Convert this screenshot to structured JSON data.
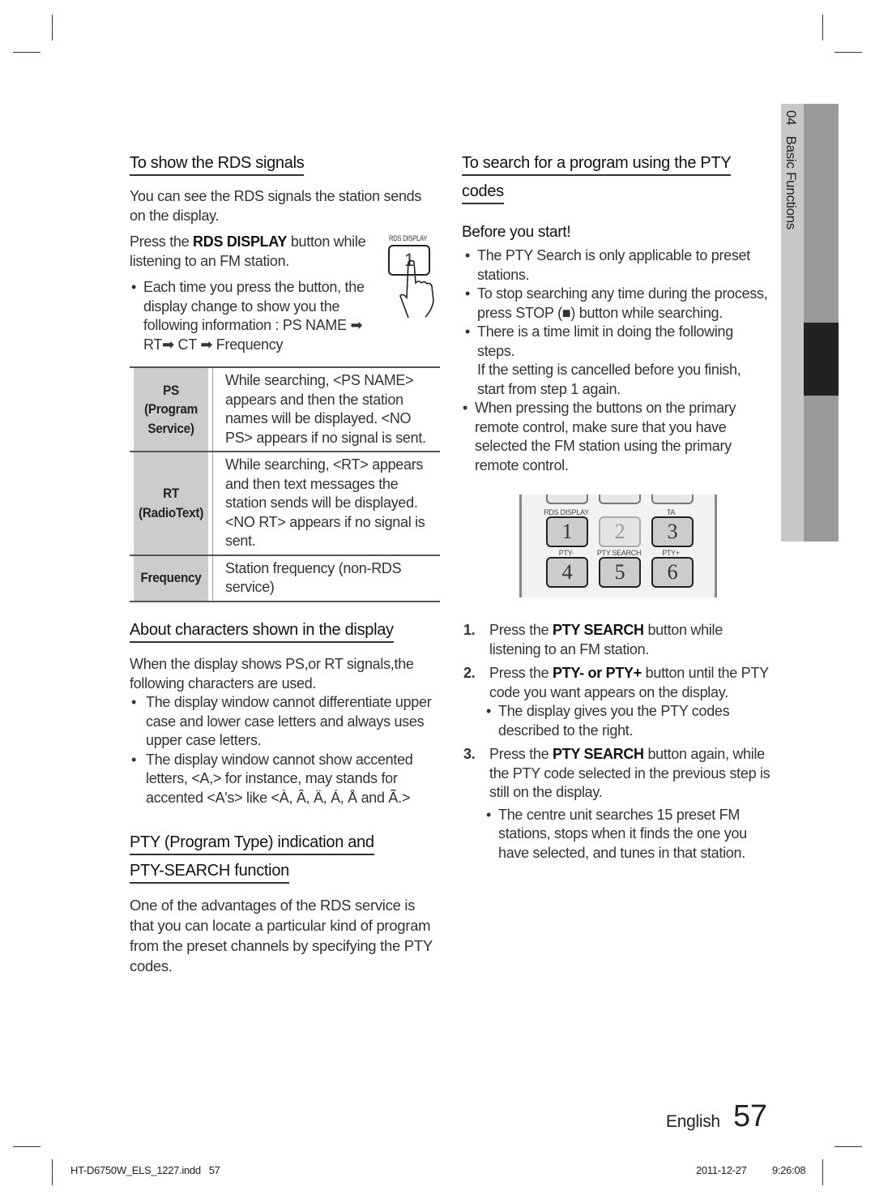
{
  "left": {
    "rds": {
      "heading": "To show the RDS signals",
      "intro": "You can see the RDS signals the station sends on the display.",
      "press_pre": "Press the ",
      "press_bold": "RDS DISPLAY",
      "press_post": " button while listening to an FM station.",
      "bullet": "Each time you press the button, the display change to show you the following information : PS NAME ➡ RT➡ CT ➡ Frequency",
      "illustration_label": "RDS DISPLAY",
      "illustration_key": "1"
    },
    "table": [
      {
        "key": "PS\n(Program\nService)",
        "value": "While searching, <PS NAME> appears and then the station names will be displayed. <NO PS> appears if no signal is sent."
      },
      {
        "key": "RT\n(RadioText)",
        "value": "While searching, <RT> appears and then text messages the station sends will be displayed. <NO RT> appears if no signal is sent."
      },
      {
        "key": "Frequency",
        "value": "Station frequency (non-RDS service)"
      }
    ],
    "chars": {
      "heading": "About characters shown in the display",
      "intro": "When the display shows PS,or RT signals,the following characters are used.",
      "bullets": [
        "The display window cannot differentiate upper case and lower case letters and always uses upper case letters.",
        "The display window cannot show accented letters, <A,> for instance, may stands for accented <A's> like <À, Â, Ä, Á, Å and Ã.>"
      ]
    },
    "pty": {
      "heading1": "PTY (Program Type) indication and",
      "heading2": "PTY-SEARCH function",
      "body": "One of the advantages of the RDS service is that you can locate a particular kind of program from the preset channels by specifying the PTY codes."
    }
  },
  "right": {
    "heading1": "To search for a program using the PTY",
    "heading2": "codes",
    "before": "Before you start!",
    "bullets": [
      "The PTY Search is only applicable to preset stations.",
      "To stop searching any time during the process, press STOP (■) button while searching.",
      "There is a time limit in doing the following steps.\nIf the setting is cancelled before you finish, start from step 1 again.",
      "When pressing the buttons on the primary remote control, make sure that you have selected the FM station using the primary remote control."
    ],
    "remote": {
      "labels": [
        "RDS DISPLAY",
        "",
        "TA",
        "PTY-",
        "PTY SEARCH",
        "PTY+"
      ],
      "keys": [
        "1",
        "2",
        "3",
        "4",
        "5",
        "6"
      ]
    },
    "steps": [
      {
        "n": "1.",
        "pre": "Press the ",
        "bold": "PTY SEARCH",
        "post": " button while listening to an FM station.",
        "sub": ""
      },
      {
        "n": "2.",
        "pre": "Press the ",
        "bold": "PTY- or PTY+",
        "post": " button until the PTY code you want appears on the display.",
        "sub": "The display gives you the PTY codes described to the right."
      },
      {
        "n": "3.",
        "pre": "Press the ",
        "bold": "PTY SEARCH",
        "post": " button again, while the PTY code selected in the previous step is still on the display.",
        "sub": "The centre unit searches 15 preset FM stations, stops when it finds the one you have selected, and tunes in that station."
      }
    ]
  },
  "side_tab": {
    "chapter": "04",
    "title": "Basic Functions"
  },
  "footer": {
    "language": "English",
    "page": "57",
    "file": "HT-D6750W_ELS_1227.indd   57",
    "date": "2011-12-27",
    "time": "9:26:08"
  }
}
